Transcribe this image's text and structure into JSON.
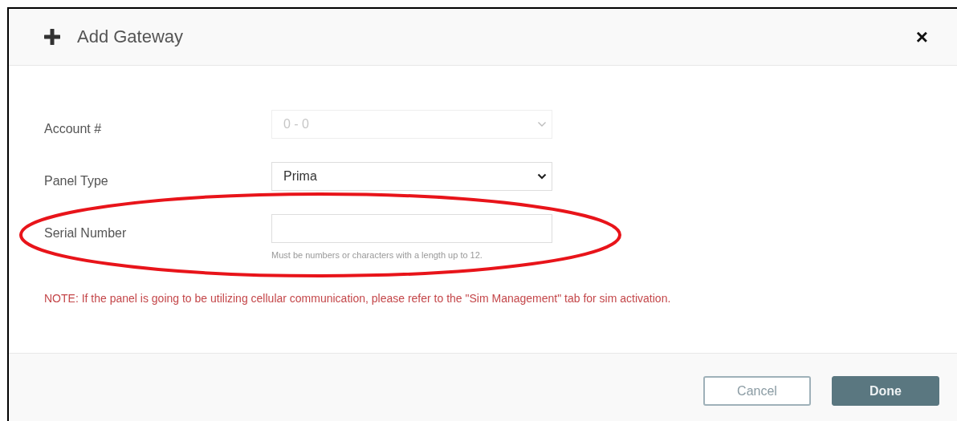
{
  "dialog": {
    "title": "Add Gateway",
    "close": "×"
  },
  "fields": [
    {
      "label": "Account #",
      "kind": "select",
      "value": "0 - 0",
      "disabled": true
    },
    {
      "label": "Panel Type",
      "kind": "select",
      "value": "Prima",
      "disabled": false
    },
    {
      "label": "Serial Number",
      "kind": "input",
      "help": "Must be numbers or characters with a length up to 12."
    }
  ],
  "note": "NOTE: If the panel is going to be utilizing cellular communication, please refer to the \"Sim Management\" tab for sim activation.",
  "buttons": [
    {
      "label": "Cancel",
      "kind": "secondary"
    },
    {
      "label": "Done",
      "kind": "primary"
    }
  ]
}
